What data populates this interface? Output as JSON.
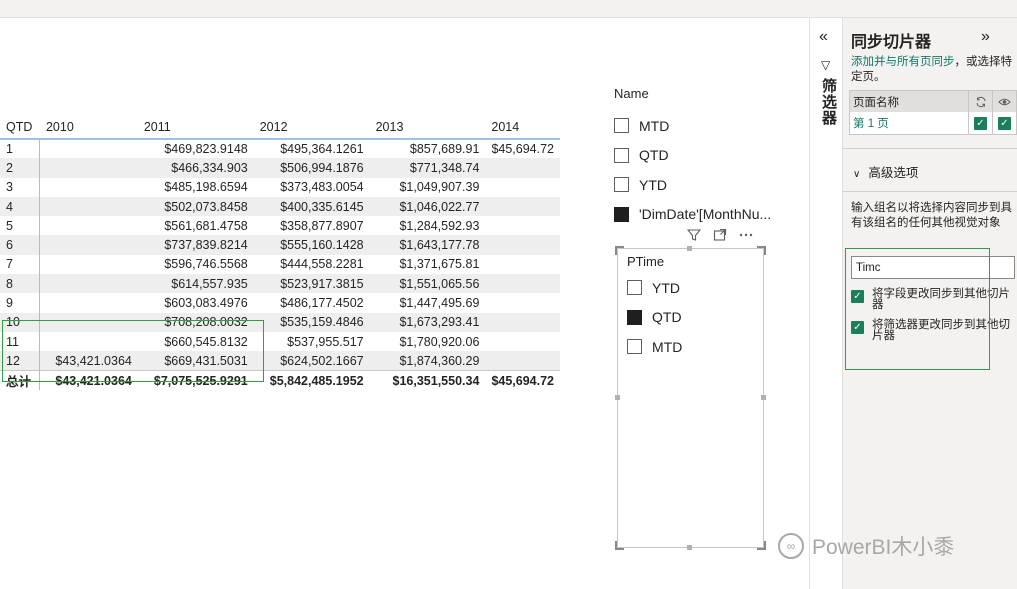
{
  "matrix": {
    "header": [
      "QTD",
      "2010",
      "2011",
      "2012",
      "2013",
      "2014"
    ],
    "rows": [
      [
        "1",
        "",
        "$469,823.9148",
        "$495,364.1261",
        "$857,689.91",
        "$45,694.72"
      ],
      [
        "2",
        "",
        "$466,334.903",
        "$506,994.1876",
        "$771,348.74",
        ""
      ],
      [
        "3",
        "",
        "$485,198.6594",
        "$373,483.0054",
        "$1,049,907.39",
        ""
      ],
      [
        "4",
        "",
        "$502,073.8458",
        "$400,335.6145",
        "$1,046,022.77",
        ""
      ],
      [
        "5",
        "",
        "$561,681.4758",
        "$358,877.8907",
        "$1,284,592.93",
        ""
      ],
      [
        "6",
        "",
        "$737,839.8214",
        "$555,160.1428",
        "$1,643,177.78",
        ""
      ],
      [
        "7",
        "",
        "$596,746.5568",
        "$444,558.2281",
        "$1,371,675.81",
        ""
      ],
      [
        "8",
        "",
        "$614,557.935",
        "$523,917.3815",
        "$1,551,065.56",
        ""
      ],
      [
        "9",
        "",
        "$603,083.4976",
        "$486,177.4502",
        "$1,447,495.69",
        ""
      ],
      [
        "10",
        "",
        "$708,208.0032",
        "$535,159.4846",
        "$1,673,293.41",
        ""
      ],
      [
        "11",
        "",
        "$660,545.8132",
        "$537,955.517",
        "$1,780,920.06",
        ""
      ],
      [
        "12",
        "$43,421.0364",
        "$669,431.5031",
        "$624,502.1667",
        "$1,874,360.29",
        ""
      ]
    ],
    "total": [
      "总计",
      "$43,421.0364",
      "$7,075,525.9291",
      "$5,842,485.1952",
      "$16,351,550.34",
      "$45,694.72"
    ]
  },
  "name_slicer": {
    "title": "Name",
    "items": [
      {
        "label": "MTD",
        "checked": false
      },
      {
        "label": "QTD",
        "checked": false
      },
      {
        "label": "YTD",
        "checked": false
      },
      {
        "label": "'DimDate'[MonthNu...",
        "checked": true
      }
    ]
  },
  "ptime_slicer": {
    "title": "PTime",
    "items": [
      {
        "label": "YTD",
        "checked": false
      },
      {
        "label": "QTD",
        "checked": true
      },
      {
        "label": "MTD",
        "checked": false
      }
    ],
    "header_icons": [
      "filter-icon",
      "focus-mode-icon",
      "more-options-icon"
    ]
  },
  "filter_pane": {
    "label": "筛选器",
    "expand_glyph": "«",
    "funnel_glyph": "▽"
  },
  "sync_pane": {
    "title": "同步切片器",
    "close_glyph": "»",
    "desc_link": "添加并与所有页同步",
    "desc_rest": "，或选择特定页。",
    "col_page": "页面名称",
    "page_name": "第 1 页",
    "advanced": "高级选项",
    "group_desc": "输入组名以将选择内容同步到具有该组名的任何其他视觉对象",
    "group_value": "Timc",
    "option1": "将字段更改同步到其他切片器",
    "option2": "将筛选器更改同步到其他切片器",
    "accent": "#1a7f5a"
  },
  "watermark": "PowerBI木小黍"
}
